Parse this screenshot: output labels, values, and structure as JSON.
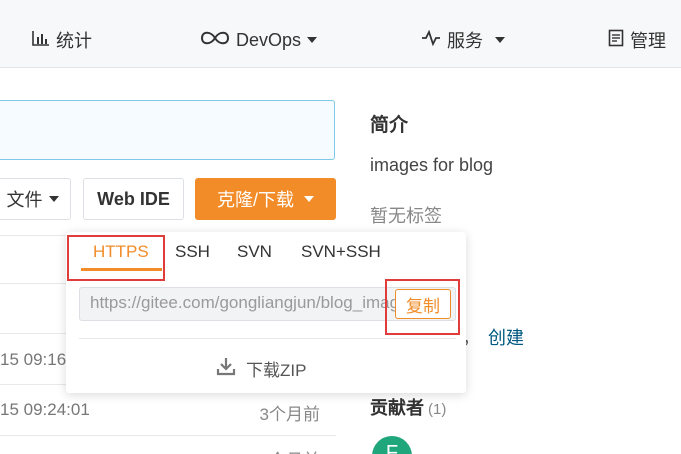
{
  "nav": {
    "stats_label": "统计",
    "devops_label": "DevOps",
    "services_label": "服务",
    "manage_label": "管理",
    "icons": [
      "bar-chart-icon",
      "infinity-icon",
      "pulse-icon",
      "clipboard-icon"
    ]
  },
  "toolbar": {
    "file_label": "文件",
    "webide_label": "Web IDE",
    "clone_label": "克隆/下载"
  },
  "clone_menu": {
    "tabs": [
      "HTTPS",
      "SSH",
      "SVN",
      "SVN+SSH"
    ],
    "active_tab": "HTTPS",
    "url": "https://gitee.com/gongliangjun/blog_images.git",
    "copy_label": "复制",
    "download_zip_label": "下载ZIP"
  },
  "commits": [
    {
      "time": "15 09:16",
      "ago": ""
    },
    {
      "time": "15 09:24:01",
      "ago": "3个月前"
    },
    {
      "time": "",
      "ago": "个月前"
    }
  ],
  "sidebar": {
    "title": "简介",
    "description": "images for blog",
    "tags": "暂无标签",
    "comma": "，",
    "create_link": "创建",
    "contributors_label": "贡献者",
    "contributors_count": "(1)",
    "avatar_letter": "F"
  },
  "colors": {
    "accent": "#f28c28",
    "highlight": "#e03c3c",
    "link": "#005980"
  }
}
